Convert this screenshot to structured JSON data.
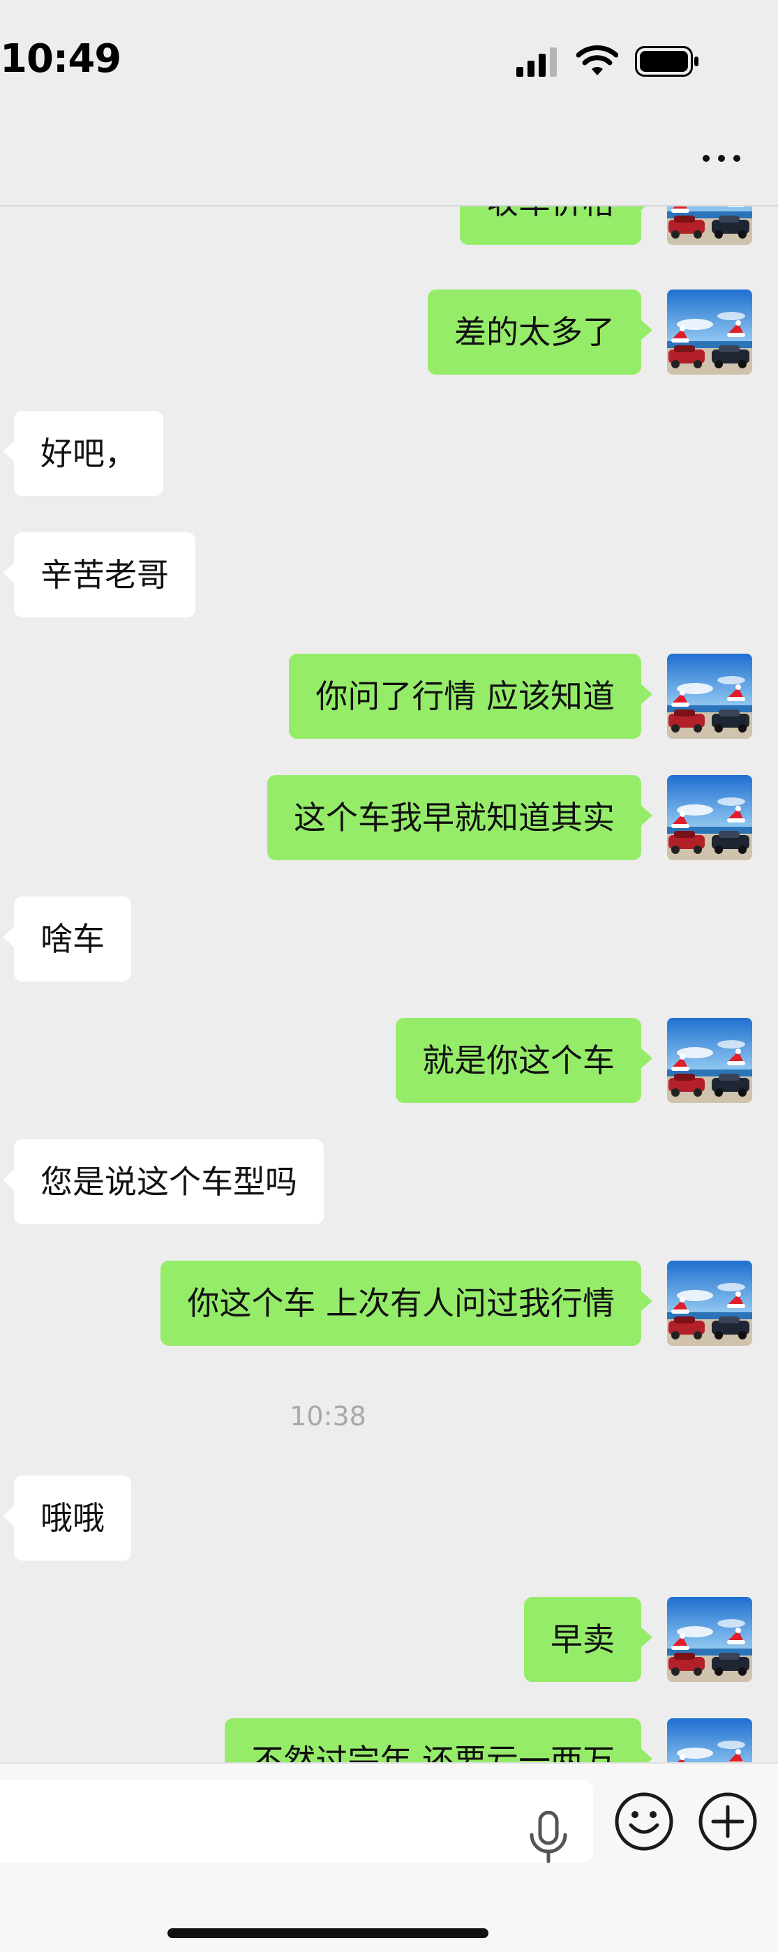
{
  "status_bar": {
    "time": "10:49"
  },
  "messages": [
    {
      "side": "me",
      "text": "收车价格"
    },
    {
      "side": "me",
      "text": "差的太多了"
    },
    {
      "side": "other",
      "text": "好吧，"
    },
    {
      "side": "other",
      "text": "辛苦老哥"
    },
    {
      "side": "me",
      "text": "你问了行情 应该知道"
    },
    {
      "side": "me",
      "text": "这个车我早就知道其实"
    },
    {
      "side": "other",
      "text": "啥车"
    },
    {
      "side": "me",
      "text": "就是你这个车"
    },
    {
      "side": "other",
      "text": "您是说这个车型吗"
    },
    {
      "side": "me",
      "text": "你这个车 上次有人问过我行情"
    },
    {
      "timestamp": "10:38"
    },
    {
      "side": "other",
      "text": "哦哦"
    },
    {
      "side": "me",
      "text": "早卖"
    },
    {
      "side": "me",
      "text": "不然过完年 还要亏一两万"
    }
  ],
  "icons": {
    "more": "more-icon",
    "mic": "microphone-icon",
    "emoji": "emoji-icon",
    "plus": "plus-icon",
    "avatar": "avatar-cars-beach"
  },
  "colors": {
    "my_bubble": "#95ec69",
    "other_bubble": "#ffffff",
    "background": "#ededed"
  }
}
